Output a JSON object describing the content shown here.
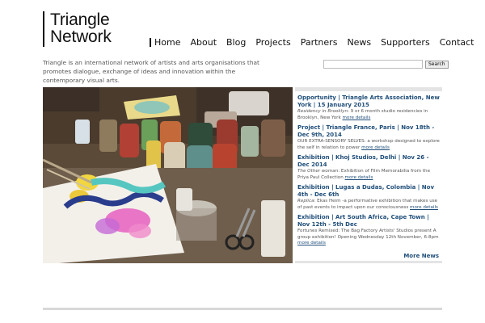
{
  "logo": {
    "line1": "Triangle",
    "line2": "Network"
  },
  "nav": [
    "Home",
    "About",
    "Blog",
    "Projects",
    "Partners",
    "News",
    "Supporters",
    "Contact"
  ],
  "tagline": "Triangle is an international network of artists and arts organisations that promotes dialogue, exchange of ideas and innovation within the contemporary visual arts.",
  "search": {
    "button_label": "Search",
    "value": ""
  },
  "news": [
    {
      "title": "Opportunity | Triangle Arts Association, New York | 15 January 2015",
      "lead": "Residency in Brooklyn",
      "text": ": 9 or 6 month studio residencies in Brooklyn, New York",
      "more": "more details"
    },
    {
      "title": "Project | Triangle France, Paris | Nov 18th - Dec 9th, 2014",
      "lead": "",
      "text": "OUR EXTRA-SENSORY SELVES: a workshop designed to explore the self in relation to power",
      "more": "more details"
    },
    {
      "title": "Exhibition | Khoj Studios, Delhi | Nov 26 - Dec 2014",
      "lead": "The Other woman",
      "text": ": Exhibition of Film Memorabilia from the Priya Paul Collection",
      "more": "more details"
    },
    {
      "title": "Exhibition | Lugas a Dudas, Colombia | Nov 4th - Dec 6th",
      "lead": "Replica",
      "text": ": Ekas Heim -a performative exhibition that makes use of past events to impact upon our consciousness",
      "more": "more details"
    },
    {
      "title": "Exhibition | Art South Africa, Cape Town | Nov 12th - 5th Dec",
      "lead": "",
      "text": "Fortunes Remixed: The Bag Factory Artists' Studios present A group exhibition! Opening Wednesday 12th November, 6-8pm",
      "more": "more details"
    }
  ],
  "more_news": "More News",
  "colors": {
    "link": "#1f4e79",
    "text": "#555555",
    "bar": "#e4e4e4"
  },
  "hero": {
    "content": "artist's table with paint jars, brushes and a watercolour painting"
  }
}
